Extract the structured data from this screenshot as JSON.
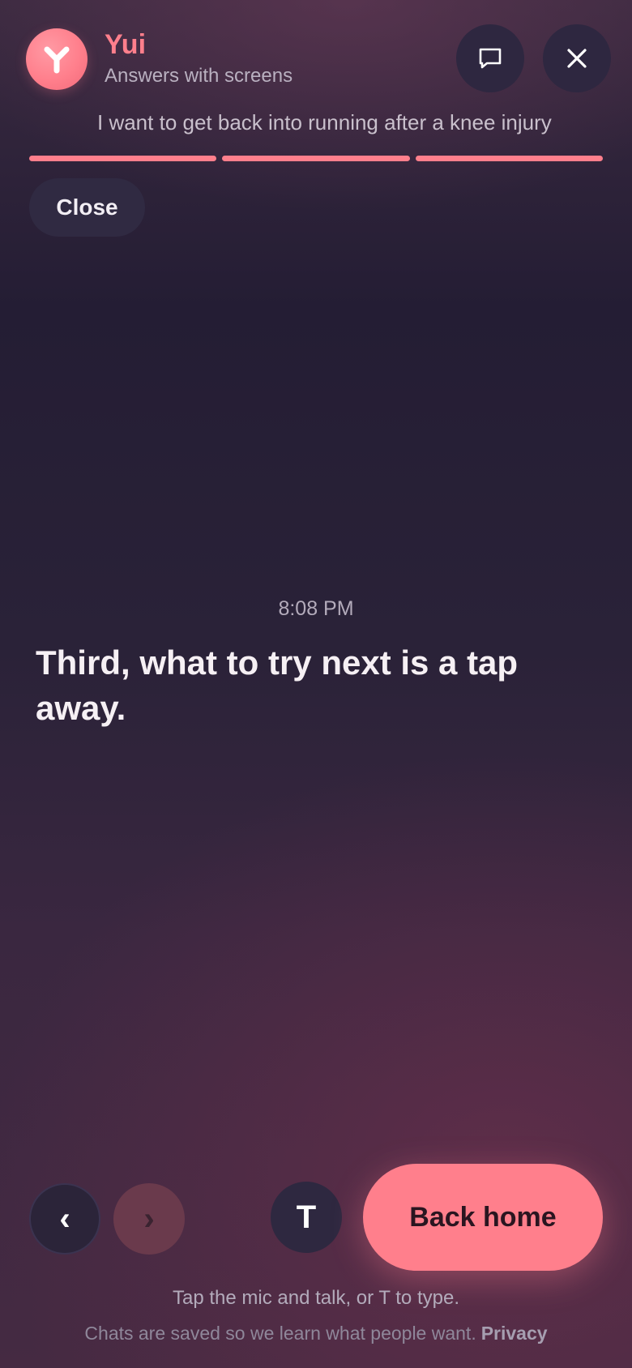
{
  "header": {
    "app_name": "Yui",
    "subtitle": "Answers with screens",
    "query_preview": "I want to get back into running after a knee injury",
    "chat_icon": "chat-bubble-icon",
    "close_icon": "close-icon",
    "progress": {
      "segments": 3,
      "filled": 3
    }
  },
  "close_button_label": "Close",
  "message": {
    "timestamp": "8:08 PM",
    "text": "Third, what to try next is a tap away."
  },
  "controls": {
    "prev_glyph": "‹",
    "next_glyph": "›",
    "type_label": "T",
    "back_home_label": "Back home"
  },
  "hint": "Tap the mic and talk, or T to type.",
  "footer": {
    "text": "Chats are saved so we learn what people want.",
    "privacy_label": "Privacy"
  },
  "colors": {
    "accent": "#ff7f8c",
    "background_top": "#241d34",
    "background_bottom": "#452a42"
  }
}
